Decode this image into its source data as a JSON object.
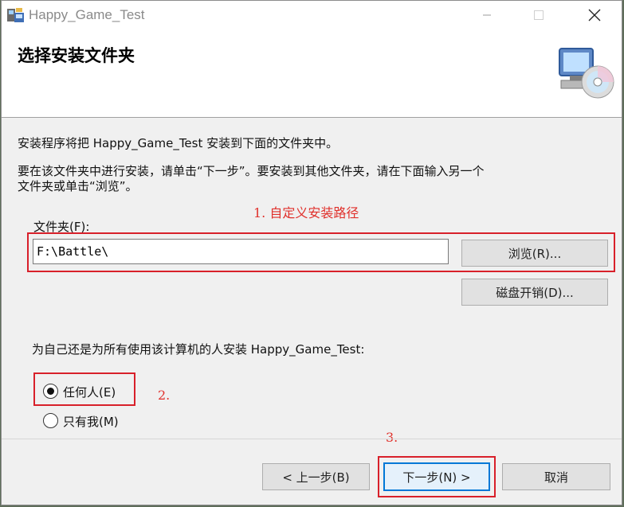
{
  "window": {
    "title": "Happy_Game_Test"
  },
  "header": {
    "title": "选择安装文件夹"
  },
  "body": {
    "intro_line1": "安装程序将把 Happy_Game_Test 安装到下面的文件夹中。",
    "intro_line2a": "要在该文件夹中进行安装，请单击“下一步”。要安装到其他文件夹，请在下面输入另一个",
    "intro_line2b": "文件夹或单击“浏览”。"
  },
  "folder": {
    "label": "文件夹(F):",
    "value": "F:\\Battle\\",
    "browse_label": "浏览(R)...",
    "disk_cost_label": "磁盘开销(D)..."
  },
  "install_for": {
    "question": "为自己还是为所有使用该计算机的人安装 Happy_Game_Test:",
    "options": [
      {
        "label": "任何人(E)",
        "selected": true
      },
      {
        "label": "只有我(M)",
        "selected": false
      }
    ]
  },
  "annotations": {
    "a1": "1. 自定义安装路径",
    "a2": "2.",
    "a3": "3."
  },
  "footer": {
    "back_label": "< 上一步(B)",
    "next_label": "下一步(N) >",
    "cancel_label": "取消"
  },
  "colors": {
    "annotation": "#e0302b",
    "default_button": "#0078d7"
  }
}
